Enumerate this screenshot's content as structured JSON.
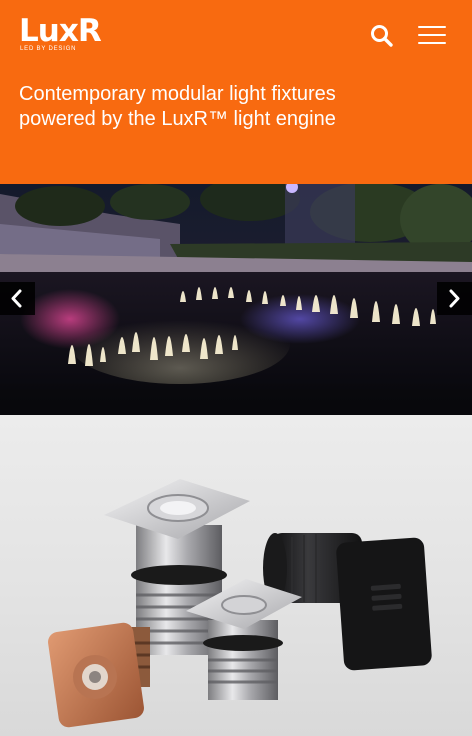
{
  "brand": {
    "logo_text": "LuxR",
    "logo_tagline": "LED BY DESIGN"
  },
  "header": {
    "search_icon": "search-icon",
    "menu_icon": "hamburger-menu-icon",
    "tagline": "Contemporary modular light fixtures powered by the LuxR™ light engine"
  },
  "carousel": {
    "prev_icon": "chevron-left-icon",
    "next_icon": "chevron-right-icon"
  },
  "colors": {
    "brand_orange": "#f86a10",
    "white": "#ffffff"
  }
}
